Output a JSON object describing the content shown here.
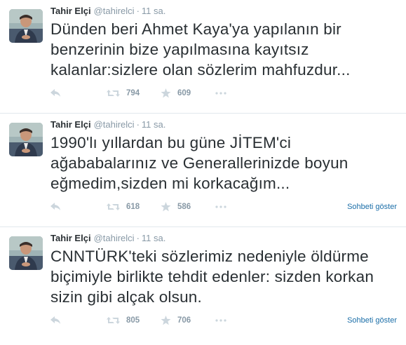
{
  "tweets": [
    {
      "fullname": "Tahir Elçi",
      "username": "@tahirelci",
      "time": "11 sa.",
      "text": "Dünden beri Ahmet Kaya'ya yapılanın bir benzerinin bize yapılmasına kayıtsız kalanlar:sizlere olan sözlerim mahfuzdur...",
      "retweets": "794",
      "favorites": "609",
      "conversation_label": ""
    },
    {
      "fullname": "Tahir Elçi",
      "username": "@tahirelci",
      "time": "11 sa.",
      "text": "1990'lı yıllardan bu güne JİTEM'ci ağababalarınız ve Generallerinizde boyun eğmedim,sizden mi korkacağım...",
      "retweets": "618",
      "favorites": "586",
      "conversation_label": "Sohbeti göster"
    },
    {
      "fullname": "Tahir Elçi",
      "username": "@tahirelci",
      "time": "11 sa.",
      "text": "CNNTÜRK'teki sözlerimiz nedeniyle öldürme biçimiyle birlikte tehdit edenler: sizden korkan sizin gibi alçak olsun.",
      "retweets": "805",
      "favorites": "706",
      "conversation_label": "Sohbeti göster"
    }
  ],
  "separator": "·",
  "icons": {
    "reply": "reply-icon",
    "retweet": "retweet-icon",
    "favorite": "star-icon",
    "more": "more-dots-icon"
  },
  "colors": {
    "text": "#292f33",
    "muted": "#8899a6",
    "link": "#1b6ea8",
    "divider": "#e1e8ed"
  }
}
